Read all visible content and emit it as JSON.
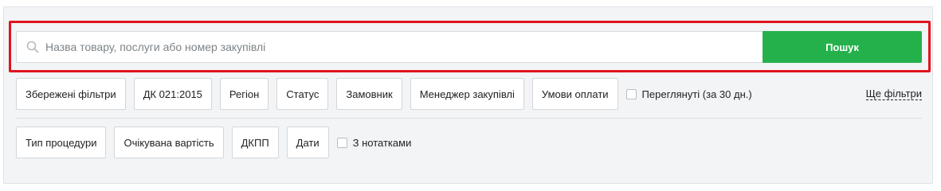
{
  "search": {
    "placeholder": "Назва товару, послуги або номер закупівлі",
    "value": "",
    "button_label": "Пошук",
    "icon": "search-icon"
  },
  "filters_row1": [
    {
      "label": "Збережені фільтри"
    },
    {
      "label": "ДК 021:2015"
    },
    {
      "label": "Регіон"
    },
    {
      "label": "Статус"
    },
    {
      "label": "Замовник"
    },
    {
      "label": "Менеджер закупівлі"
    },
    {
      "label": "Умови оплати"
    }
  ],
  "viewed_checkbox": {
    "label": "Переглянуті (за 30 дн.)",
    "checked": false
  },
  "more_filters_label": "Ще фільтри",
  "filters_row2": [
    {
      "label": "Тип процедури"
    },
    {
      "label": "Очікувана вартість"
    },
    {
      "label": "ДКПП"
    },
    {
      "label": "Дати"
    }
  ],
  "notes_checkbox": {
    "label": "З нотатками",
    "checked": false
  },
  "colors": {
    "accent_green": "#24b14c",
    "highlight_red": "#e0141e",
    "panel_bg": "#f2f4f6"
  }
}
